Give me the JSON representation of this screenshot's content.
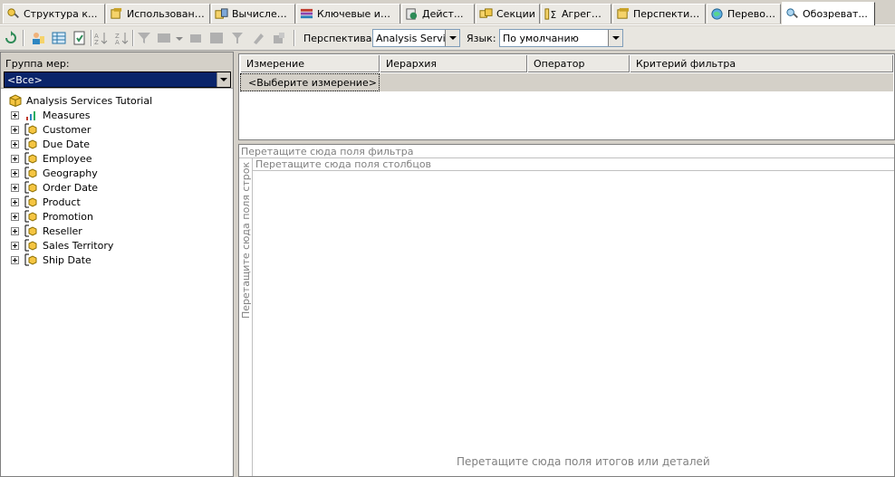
{
  "tabs": [
    {
      "label": "Структура к...",
      "icon": "cube-structure-icon"
    },
    {
      "label": "Использовани...",
      "icon": "dimension-usage-icon"
    },
    {
      "label": "Вычисления",
      "icon": "calculations-icon"
    },
    {
      "label": "Ключевые ин...",
      "icon": "kpi-icon"
    },
    {
      "label": "Дейст...",
      "icon": "actions-icon"
    },
    {
      "label": "Секции",
      "icon": "partitions-icon"
    },
    {
      "label": "Агрега...",
      "icon": "aggregations-icon"
    },
    {
      "label": "Перспективы",
      "icon": "perspectives-icon"
    },
    {
      "label": "Переводы",
      "icon": "translations-icon"
    },
    {
      "label": "Обозреват...",
      "icon": "browser-icon"
    }
  ],
  "toolbar": {
    "perspective_label": "Перспектива:",
    "perspective_value": "Analysis Services",
    "language_label": "Язык:",
    "language_value": "По умолчанию"
  },
  "left_panel": {
    "measure_group_label": "Группа мер:",
    "measure_group_value": "<Все>",
    "root": "Analysis Services Tutorial",
    "items": [
      {
        "label": "Measures",
        "icon": "measures-icon"
      },
      {
        "label": "Customer",
        "icon": "dimension-icon"
      },
      {
        "label": "Due Date",
        "icon": "dimension-icon"
      },
      {
        "label": "Employee",
        "icon": "dimension-icon"
      },
      {
        "label": "Geography",
        "icon": "dimension-icon"
      },
      {
        "label": "Order Date",
        "icon": "dimension-icon"
      },
      {
        "label": "Product",
        "icon": "dimension-icon"
      },
      {
        "label": "Promotion",
        "icon": "dimension-icon"
      },
      {
        "label": "Reseller",
        "icon": "dimension-icon"
      },
      {
        "label": "Sales Territory",
        "icon": "dimension-icon"
      },
      {
        "label": "Ship Date",
        "icon": "dimension-icon"
      }
    ]
  },
  "filter_grid": {
    "columns": [
      "Измерение",
      "Иерархия",
      "Оператор",
      "Критерий фильтра"
    ],
    "row_placeholder": "<Выберите измерение>"
  },
  "pivot": {
    "filter_drop": "Перетащите сюда поля фильтра",
    "column_drop": "Перетащите сюда поля столбцов",
    "row_drop": "Перетащите сюда поля строк",
    "data_drop": "Перетащите сюда поля итогов или деталей"
  },
  "colors": {
    "selection": "#0a246a",
    "chrome": "#d4d0c8"
  }
}
